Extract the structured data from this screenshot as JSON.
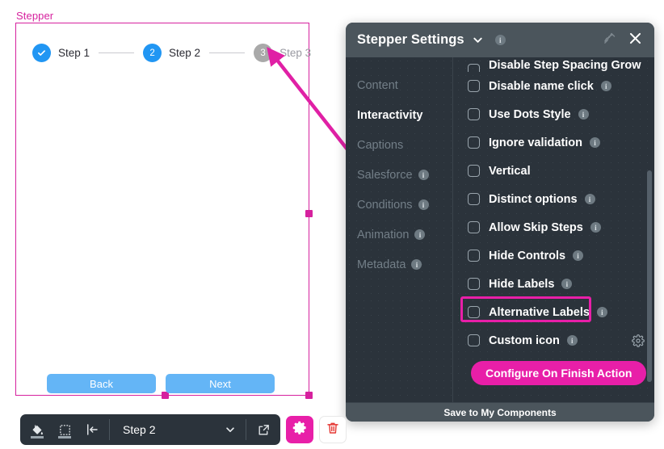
{
  "canvas": {
    "component_label": "Stepper",
    "stepper": {
      "steps": [
        {
          "index": "1",
          "name": "Step 1",
          "state": "done",
          "glyph": "check"
        },
        {
          "index": "2",
          "name": "Step 2",
          "state": "current",
          "glyph": "2"
        },
        {
          "index": "3",
          "name": "Step 3",
          "state": "todo",
          "glyph": "3"
        }
      ]
    },
    "nav_buttons": {
      "back_label": "Back",
      "next_label": "Next"
    },
    "selection_color": "#d6219e",
    "annotation": {
      "type": "arrow",
      "points_from": "Alternative Labels",
      "points_to": "Step 3",
      "color": "#e81fa8"
    }
  },
  "panel": {
    "title": "Stepper Settings",
    "title_chevron_icon": "chevron-down-icon",
    "title_info_icon": "info-icon",
    "pin_icon": "pin-icon",
    "close_icon": "close-icon",
    "nav": {
      "items": [
        {
          "label": "Content",
          "active": false,
          "info": false
        },
        {
          "label": "Interactivity",
          "active": true,
          "info": false
        },
        {
          "label": "Captions",
          "active": false,
          "info": false
        },
        {
          "label": "Salesforce",
          "active": false,
          "info": true
        },
        {
          "label": "Conditions",
          "active": false,
          "info": true
        },
        {
          "label": "Animation",
          "active": false,
          "info": true
        },
        {
          "label": "Metadata",
          "active": false,
          "info": true
        }
      ]
    },
    "options": [
      {
        "label": "Disable Step Spacing Grow",
        "checked": false,
        "info": false,
        "clipped": true,
        "highlighted": false,
        "gear": false
      },
      {
        "label": "Disable name click",
        "checked": false,
        "info": true,
        "clipped": false,
        "highlighted": false,
        "gear": false
      },
      {
        "label": "Use Dots Style",
        "checked": false,
        "info": true,
        "clipped": false,
        "highlighted": false,
        "gear": false
      },
      {
        "label": "Ignore validation",
        "checked": false,
        "info": true,
        "clipped": false,
        "highlighted": false,
        "gear": false
      },
      {
        "label": "Vertical",
        "checked": false,
        "info": false,
        "clipped": false,
        "highlighted": false,
        "gear": false
      },
      {
        "label": "Distinct options",
        "checked": false,
        "info": true,
        "clipped": false,
        "highlighted": false,
        "gear": false
      },
      {
        "label": "Allow Skip Steps",
        "checked": false,
        "info": true,
        "clipped": false,
        "highlighted": false,
        "gear": false
      },
      {
        "label": "Hide Controls",
        "checked": false,
        "info": true,
        "clipped": false,
        "highlighted": false,
        "gear": false
      },
      {
        "label": "Hide Labels",
        "checked": false,
        "info": true,
        "clipped": false,
        "highlighted": false,
        "gear": false
      },
      {
        "label": "Alternative Labels",
        "checked": false,
        "info": true,
        "clipped": false,
        "highlighted": true,
        "gear": false
      },
      {
        "label": "Custom icon",
        "checked": false,
        "info": true,
        "clipped": false,
        "highlighted": false,
        "gear": true
      }
    ],
    "configure_button_label": "Configure On Finish Action",
    "footer_label": "Save to My Components",
    "accent_color": "#e81fa8",
    "info_icon_name": "info-icon",
    "gear_icon_name": "gear-icon"
  },
  "toolbar": {
    "fill_icon": "paint-bucket-icon",
    "border_icon": "border-box-icon",
    "align_icon": "align-left-icon",
    "step_select_value": "Step 2",
    "step_select_chevron": "chevron-down-icon",
    "open_external_icon": "open-external-icon",
    "settings_icon": "gear-icon",
    "delete_icon": "trash-icon"
  }
}
